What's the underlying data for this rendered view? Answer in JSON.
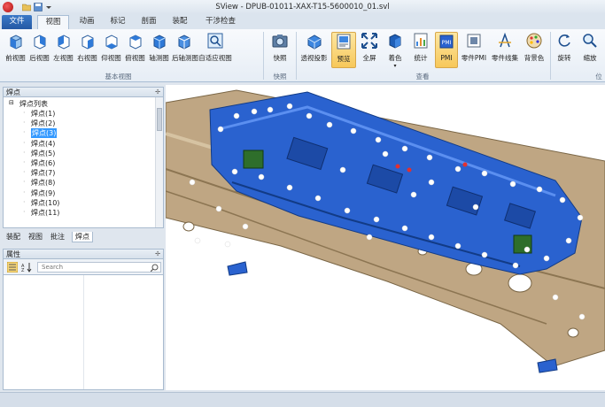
{
  "window": {
    "title": "SView - DPUB-01011-XAX-T15-5600010_01.svl"
  },
  "tabs": [
    {
      "label": "文件",
      "kind": "file"
    },
    {
      "label": "视图",
      "kind": "active"
    },
    {
      "label": "动画"
    },
    {
      "label": "标记"
    },
    {
      "label": "剖面"
    },
    {
      "label": "装配"
    },
    {
      "label": "干涉检查"
    }
  ],
  "ribbon": {
    "groups": [
      {
        "label": "基本视图"
      },
      {
        "label": "快照"
      },
      {
        "label": "查看"
      },
      {
        "label": "位"
      }
    ],
    "buttons": [
      {
        "label": "前视图",
        "icon": "front-view-icon"
      },
      {
        "label": "后视图",
        "icon": "back-view-icon"
      },
      {
        "label": "左视图",
        "icon": "left-view-icon"
      },
      {
        "label": "右视图",
        "icon": "right-view-icon"
      },
      {
        "label": "仰视图",
        "icon": "bottom-view-icon"
      },
      {
        "label": "俯视图",
        "icon": "top-view-icon"
      },
      {
        "label": "轴测图",
        "icon": "iso-view-icon"
      },
      {
        "label": "后轴测图",
        "icon": "back-iso-view-icon"
      },
      {
        "label": "自适应视图",
        "icon": "fit-view-icon"
      },
      {
        "label": "快照",
        "icon": "snapshot-icon"
      },
      {
        "label": "透视投影",
        "icon": "perspective-icon"
      },
      {
        "label": "预览",
        "icon": "preview-icon",
        "pressed": true
      },
      {
        "label": "全屏",
        "icon": "fullscreen-icon"
      },
      {
        "label": "着色",
        "icon": "shading-icon",
        "dropdown": true
      },
      {
        "label": "统计",
        "icon": "statistics-icon"
      },
      {
        "label": "PMI",
        "icon": "pmi-icon",
        "pressed": true
      },
      {
        "label": "零件PMI",
        "icon": "part-pmi-icon"
      },
      {
        "label": "零件线集",
        "icon": "part-lineset-icon"
      },
      {
        "label": "背景色",
        "icon": "background-color-icon"
      },
      {
        "label": "旋转",
        "icon": "rotate-icon"
      },
      {
        "label": "缩放",
        "icon": "zoom-icon"
      }
    ]
  },
  "weld_panel": {
    "title": "焊点",
    "root": "焊点列表",
    "items": [
      "焊点(1)",
      "焊点(2)",
      "焊点(3)",
      "焊点(4)",
      "焊点(5)",
      "焊点(6)",
      "焊点(7)",
      "焊点(8)",
      "焊点(9)",
      "焊点(10)",
      "焊点(11)"
    ],
    "selected_index": 2
  },
  "dock_tabs": [
    "装配",
    "视图",
    "批注",
    "焊点"
  ],
  "properties": {
    "title": "属性",
    "search_placeholder": "Search"
  },
  "colors": {
    "part_blue": "#2a62cf",
    "part_tan": "#b9a17e",
    "ribbon_bg": "#e6edf5",
    "selection": "#3399ff"
  }
}
